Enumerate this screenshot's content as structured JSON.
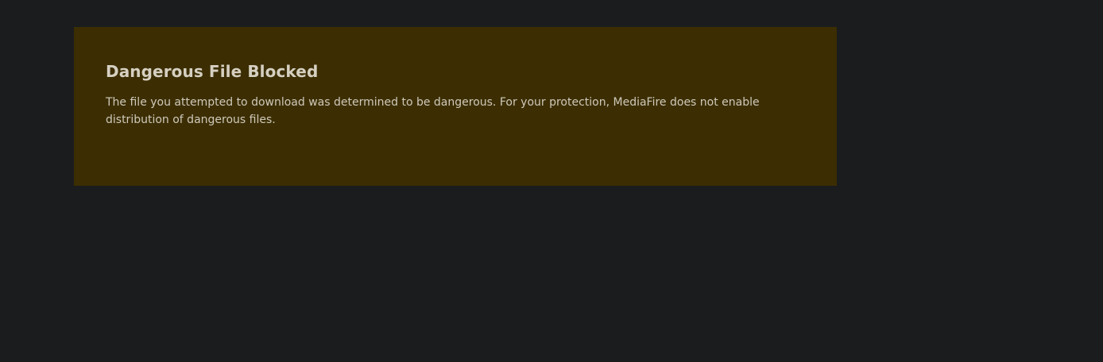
{
  "theme": {
    "page_background": "#1b1c1e",
    "notice_background": "#3c2e02",
    "title_color": "#d6d0c2",
    "text_color": "#cfc9bb"
  },
  "notice": {
    "title": "Dangerous File Blocked",
    "message": "The file you attempted to download was determined to be dangerous. For your protection, MediaFire does not enable distribution of dangerous files."
  }
}
